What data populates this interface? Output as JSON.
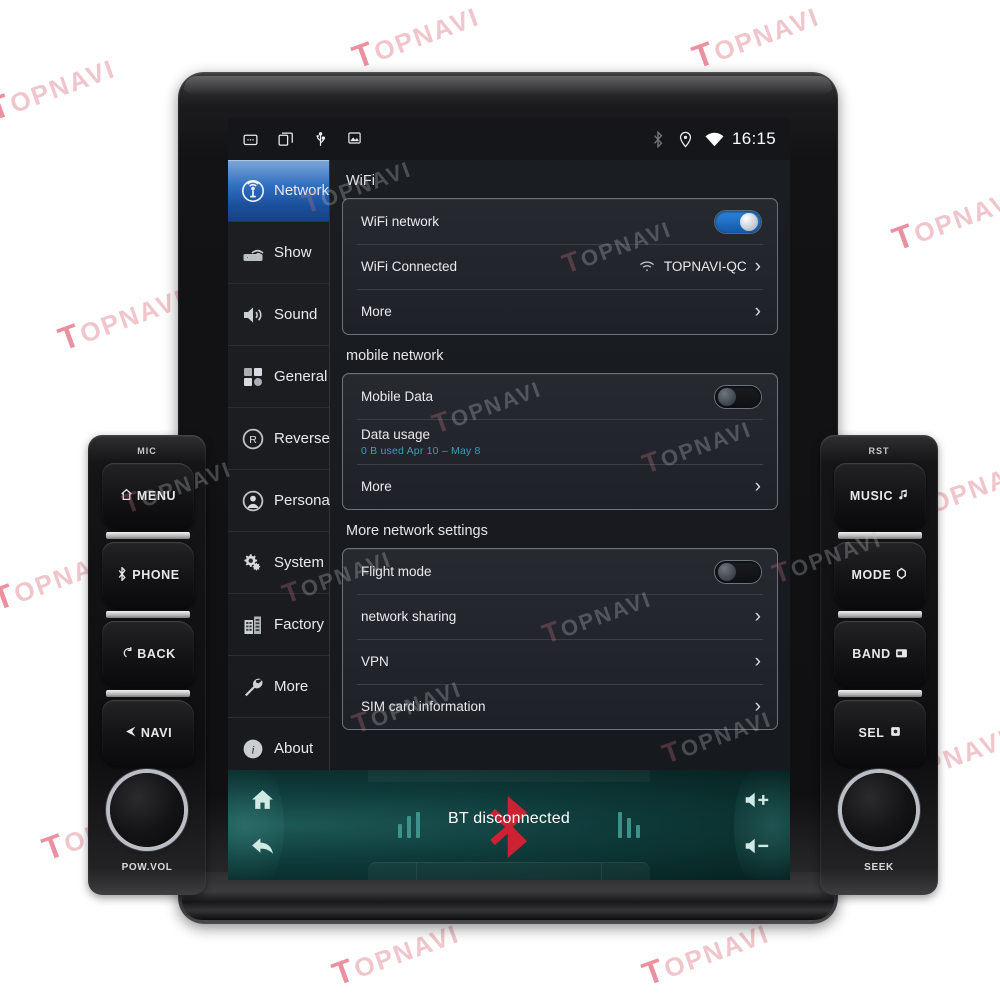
{
  "brand": {
    "watermark": "TOPNAVI",
    "watermark_initial": "T"
  },
  "statusbar": {
    "icons_left": [
      "recents-icon",
      "multiwindow-icon",
      "usb-icon",
      "screenshot-icon"
    ],
    "icons_right": [
      "bluetooth-icon",
      "location-icon",
      "wifi-icon"
    ],
    "clock": "16:15"
  },
  "sidebar": {
    "items": [
      {
        "label": "Network",
        "icon": "network-antenna-icon",
        "active": true
      },
      {
        "label": "Show",
        "icon": "display-router-icon",
        "active": false
      },
      {
        "label": "Sound",
        "icon": "speaker-icon",
        "active": false
      },
      {
        "label": "General",
        "icon": "grid-squares-icon",
        "active": false
      },
      {
        "label": "Reverse",
        "icon": "reverse-r-icon",
        "active": false
      },
      {
        "label": "Personal",
        "icon": "person-icon",
        "active": false
      },
      {
        "label": "System",
        "icon": "gears-icon",
        "active": false
      },
      {
        "label": "Factory",
        "icon": "factory-building-icon",
        "active": false
      },
      {
        "label": "More",
        "icon": "wrench-icon",
        "active": false
      },
      {
        "label": "About",
        "icon": "info-icon",
        "active": false
      }
    ]
  },
  "content": {
    "sections": [
      {
        "title": "WiFi",
        "rows": [
          {
            "label": "WiFi network",
            "control": "toggle",
            "toggle_state": "on"
          },
          {
            "label": "WiFi Connected",
            "control": "value-chevron",
            "value": "TOPNAVI-QC",
            "value_icon": "wifi-small-icon"
          },
          {
            "label": "More",
            "control": "chevron"
          }
        ]
      },
      {
        "title": "mobile network",
        "rows": [
          {
            "label": "Mobile Data",
            "control": "toggle",
            "toggle_state": "off"
          },
          {
            "label": "Data usage",
            "control": "sub",
            "sub": "0 B used Apr 10 – May 8"
          },
          {
            "label": "More",
            "control": "chevron"
          }
        ]
      },
      {
        "title": "More network settings",
        "rows": [
          {
            "label": "Flight mode",
            "control": "toggle",
            "toggle_state": "off"
          },
          {
            "label": "network sharing",
            "control": "chevron"
          },
          {
            "label": "VPN",
            "control": "chevron"
          },
          {
            "label": "SIM card information",
            "control": "chevron"
          }
        ]
      }
    ]
  },
  "mediabar": {
    "status_text": "BT disconnected",
    "bt_logo_color": "#cc2233",
    "buttons": [
      {
        "name": "home-button",
        "icon": "home-icon"
      },
      {
        "name": "back-button",
        "icon": "back-arrow-icon"
      },
      {
        "name": "volume-up-button",
        "icon": "volume-plus-icon"
      },
      {
        "name": "volume-down-button",
        "icon": "volume-minus-icon"
      }
    ]
  },
  "hardware": {
    "left_panel": {
      "top_label": "MIC",
      "keys": [
        {
          "label": "MENU",
          "icon": "home-outline-icon"
        },
        {
          "label": "PHONE",
          "icon": "bluetooth-small-icon"
        },
        {
          "label": "BACK",
          "icon": "return-arrow-icon"
        },
        {
          "label": "NAVI",
          "icon": "nav-triangle-icon"
        }
      ],
      "knob_label": "POW.VOL"
    },
    "right_panel": {
      "top_label": "RST",
      "keys": [
        {
          "label": "MUSIC",
          "icon": "music-note-icon"
        },
        {
          "label": "MODE",
          "icon": "mode-hex-icon"
        },
        {
          "label": "BAND",
          "icon": "band-radio-icon"
        },
        {
          "label": "SEL",
          "icon": "select-gear-icon"
        }
      ],
      "knob_label": "SEEK"
    }
  },
  "colors": {
    "accent_blue": "#2a86dd",
    "sidebar_active_top": "#7fa8d8",
    "data_usage_teal": "#3e9bb8",
    "media_teal": "#0e3b3a",
    "bt_red": "#cc2233"
  }
}
